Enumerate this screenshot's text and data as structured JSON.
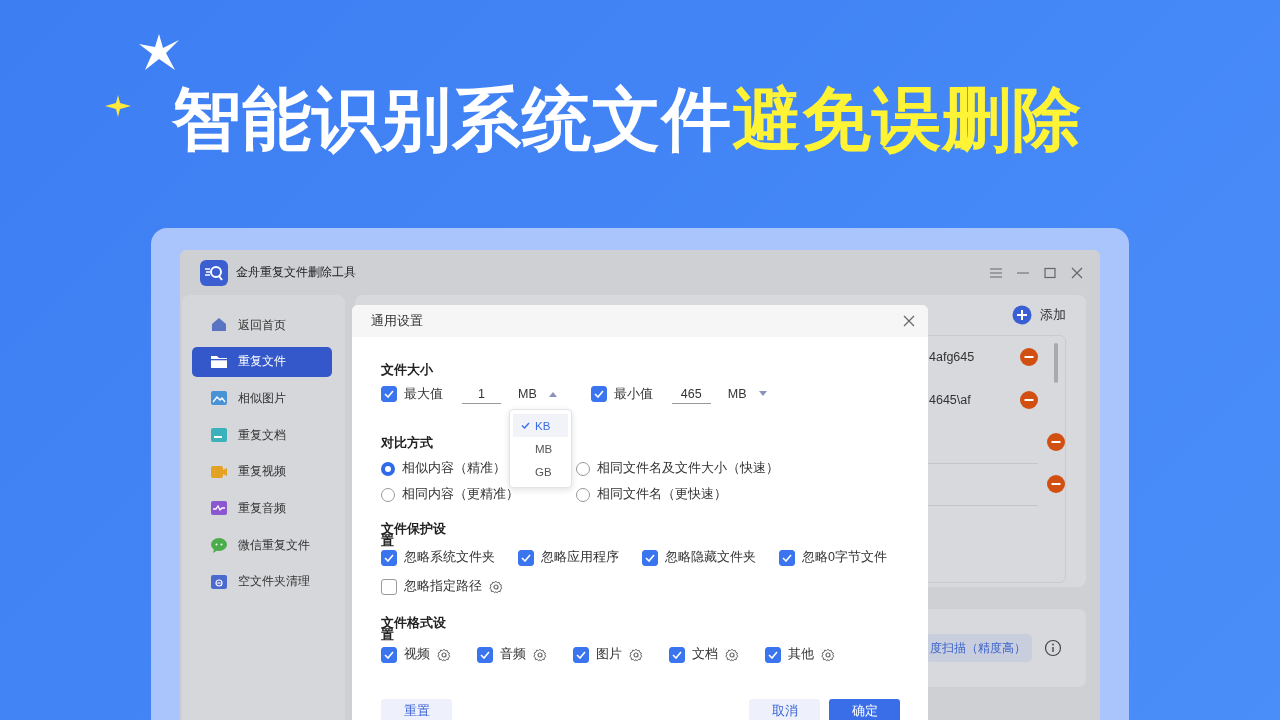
{
  "headline": {
    "text": "智能识别系统文件",
    "highlight": "避免误删除"
  },
  "window": {
    "title": "金舟重复文件删除工具"
  },
  "sidebar": {
    "items": [
      {
        "label": "返回首页",
        "selected": false
      },
      {
        "label": "重复文件",
        "selected": true
      },
      {
        "label": "相似图片",
        "selected": false
      },
      {
        "label": "重复文档",
        "selected": false
      },
      {
        "label": "重复视频",
        "selected": false
      },
      {
        "label": "重复音频",
        "selected": false
      },
      {
        "label": "微信重复文件",
        "selected": false
      },
      {
        "label": "空文件夹清理",
        "selected": false
      }
    ]
  },
  "main": {
    "add_label": "添加",
    "rows": [
      {
        "path": "4afg645",
        "divider": false
      },
      {
        "path": "4645\\af",
        "divider": false
      },
      {
        "divider": true
      },
      {
        "divider": true
      }
    ],
    "scan_button": "度扫描（精度高）"
  },
  "dialog": {
    "title": "通用设置",
    "file_size": {
      "heading": "文件大小",
      "fields": [
        {
          "label": "最大值",
          "value": "1",
          "unit": "MB",
          "checked": true,
          "open": true
        },
        {
          "label": "最小值",
          "value": "465",
          "unit": "MB",
          "checked": true,
          "open": false
        }
      ],
      "unit_options": [
        {
          "label": "KB",
          "selected": true
        },
        {
          "label": "MB",
          "selected": false
        },
        {
          "label": "GB",
          "selected": false
        }
      ]
    },
    "compare": {
      "heading": "对比方式",
      "options": [
        {
          "label": "相似内容（精准）",
          "selected": true
        },
        {
          "label": "相同文件名及文件大小（快速）",
          "selected": false
        },
        {
          "label": "相同内容（更精准）",
          "selected": false
        },
        {
          "label": "相同文件名（更快速）",
          "selected": false
        }
      ]
    },
    "protection": {
      "heading": "文件保护设置",
      "items": [
        {
          "label": "忽略系统文件夹",
          "checked": true,
          "settings": false
        },
        {
          "label": "忽略应用程序",
          "checked": true,
          "settings": false
        },
        {
          "label": "忽略隐藏文件夹",
          "checked": true,
          "settings": false
        },
        {
          "label": "忽略0字节文件",
          "checked": true,
          "settings": false
        },
        {
          "label": "忽略指定路径",
          "checked": false,
          "settings": true
        }
      ]
    },
    "formats": {
      "heading": "文件格式设置",
      "items": [
        {
          "label": "视频",
          "checked": true,
          "settings": true
        },
        {
          "label": "音频",
          "checked": true,
          "settings": true
        },
        {
          "label": "图片",
          "checked": true,
          "settings": true
        },
        {
          "label": "文档",
          "checked": true,
          "settings": true
        },
        {
          "label": "其他",
          "checked": true,
          "settings": true
        }
      ]
    },
    "buttons": [
      {
        "label": "重置",
        "kind": "secondary"
      },
      {
        "label": "取消",
        "kind": "secondary"
      },
      {
        "label": "确定",
        "kind": "primary"
      }
    ]
  }
}
